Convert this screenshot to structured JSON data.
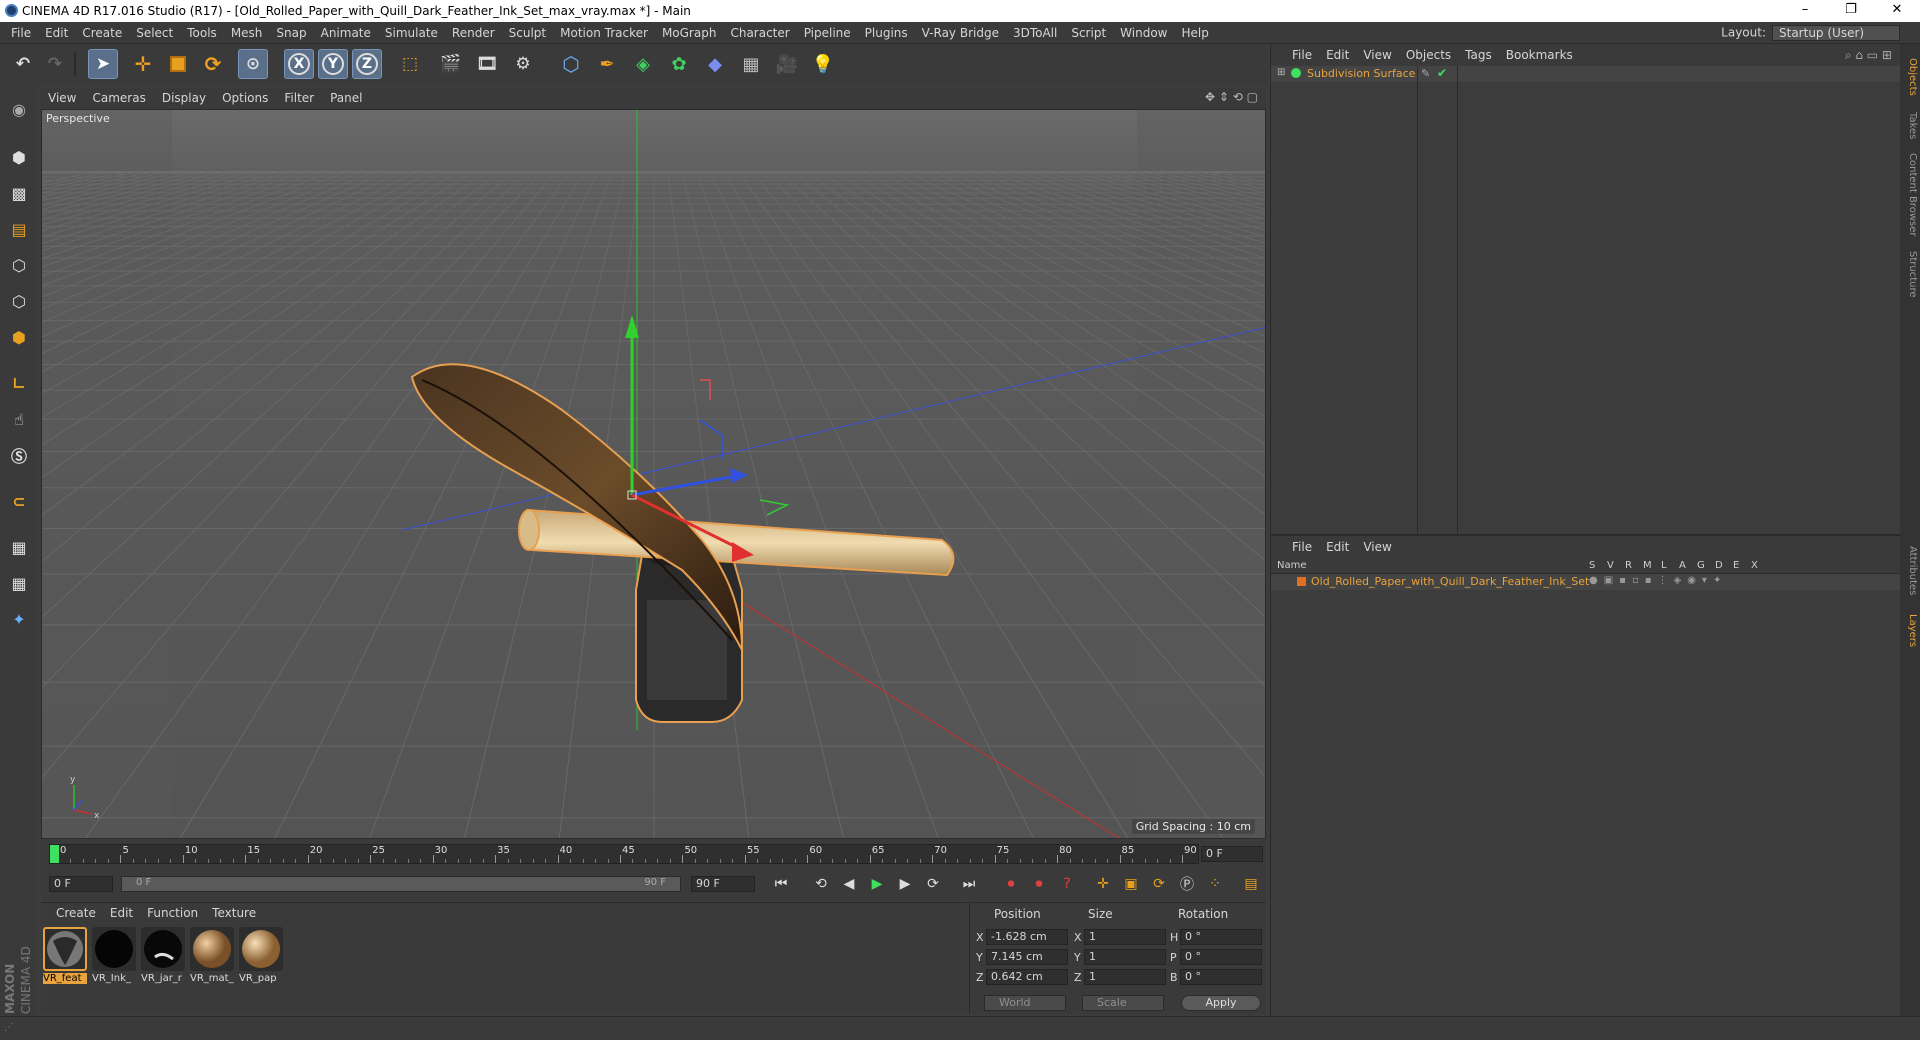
{
  "window": {
    "title": "CINEMA 4D R17.016 Studio (R17) - [Old_Rolled_Paper_with_Quill_Dark_Feather_Ink_Set_max_vray.max *] - Main",
    "minimize": "–",
    "maximize": "❐",
    "close": "✕"
  },
  "menubar": {
    "items": [
      "File",
      "Edit",
      "Create",
      "Select",
      "Tools",
      "Mesh",
      "Snap",
      "Animate",
      "Simulate",
      "Render",
      "Sculpt",
      "Motion Tracker",
      "MoGraph",
      "Character",
      "Pipeline",
      "Plugins",
      "V-Ray Bridge",
      "3DToAll",
      "Script",
      "Window",
      "Help"
    ],
    "layout_label": "Layout:",
    "layout_value": "Startup (User)"
  },
  "toolbar": {
    "axis_x": "X",
    "axis_y": "Y",
    "axis_z": "Z"
  },
  "viewport": {
    "menu": [
      "View",
      "Cameras",
      "Display",
      "Options",
      "Filter",
      "Panel"
    ],
    "label": "Perspective",
    "grid_spacing": "Grid Spacing : 10 cm"
  },
  "timeline": {
    "ticks": [
      "0",
      "5",
      "10",
      "15",
      "20",
      "25",
      "30",
      "35",
      "40",
      "45",
      "50",
      "55",
      "60",
      "65",
      "70",
      "75",
      "80",
      "85",
      "90"
    ],
    "current_frame": "0 F",
    "start_frame": "0 F",
    "range_start": "0 F",
    "range_end": "90 F",
    "end_frame": "90 F"
  },
  "materials": {
    "menu": [
      "Create",
      "Edit",
      "Function",
      "Texture"
    ],
    "items": [
      {
        "label": "VR_feat",
        "kind": "feather"
      },
      {
        "label": "VR_Ink_",
        "kind": "ink"
      },
      {
        "label": "VR_jar_r",
        "kind": "jar"
      },
      {
        "label": "VR_mat_",
        "kind": "paper"
      },
      {
        "label": "VR_pap",
        "kind": "paper2"
      }
    ]
  },
  "coordinates": {
    "headers": {
      "position": "Position",
      "size": "Size",
      "rotation": "Rotation"
    },
    "rows": [
      {
        "axis": "X",
        "pos": "-1.628 cm",
        "size_axis": "X",
        "size": "1",
        "rot_axis": "H",
        "rot": "0 °"
      },
      {
        "axis": "Y",
        "pos": "7.145 cm",
        "size_axis": "Y",
        "size": "1",
        "rot_axis": "P",
        "rot": "0 °"
      },
      {
        "axis": "Z",
        "pos": "0.642 cm",
        "size_axis": "Z",
        "size": "1",
        "rot_axis": "B",
        "rot": "0 °"
      }
    ],
    "space": "World",
    "mode": "Scale",
    "apply": "Apply"
  },
  "objects": {
    "menu": [
      "File",
      "Edit",
      "View",
      "Objects",
      "Tags",
      "Bookmarks"
    ],
    "items": [
      {
        "name": "Subdivision Surface"
      }
    ]
  },
  "layers": {
    "menu": [
      "File",
      "Edit",
      "View"
    ],
    "columns": [
      "Name",
      "S",
      "V",
      "R",
      "M",
      "L",
      "A",
      "G",
      "D",
      "E",
      "X"
    ],
    "rows": [
      {
        "name": "Old_Rolled_Paper_with_Quill_Dark_Feather_Ink_Set"
      }
    ]
  },
  "sidetabs": [
    "Objects",
    "Takes",
    "Content Browser",
    "Structure",
    "Attributes",
    "Layers"
  ],
  "brand": {
    "maxon": "MAXON",
    "product": "CINEMA 4D"
  },
  "colors": {
    "accent": "#e8a33c",
    "selection": "#5a6f8a",
    "axis_x": "#e03030",
    "axis_y": "#30c030",
    "axis_z": "#3050e0"
  }
}
